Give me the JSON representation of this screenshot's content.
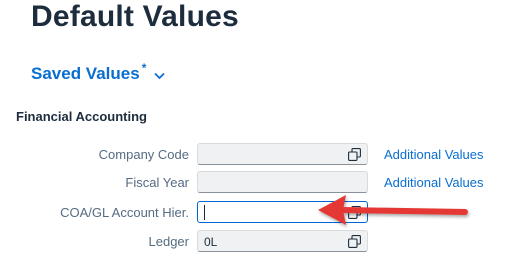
{
  "page": {
    "title": "Default Values"
  },
  "variant": {
    "label": "Saved Values",
    "modified_marker": "*"
  },
  "section": {
    "title": "Financial Accounting"
  },
  "fields": [
    {
      "label": "Company Code",
      "value": "",
      "has_value_help": true,
      "link": "Additional Values"
    },
    {
      "label": "Fiscal Year",
      "value": "",
      "has_value_help": false,
      "link": "Additional Values"
    },
    {
      "label": "COA/GL Account Hier.",
      "value": "",
      "has_value_help": true,
      "focused": true
    },
    {
      "label": "Ledger",
      "value": "0L",
      "has_value_help": true
    }
  ],
  "annotation": {
    "type": "red-arrow",
    "color": "#e53935",
    "points_to": "COA/GL Account Hier."
  },
  "colors": {
    "title": "#1d2d3e",
    "link": "#0a6ed1",
    "label": "#556b82",
    "focus_border": "#0064d9"
  }
}
